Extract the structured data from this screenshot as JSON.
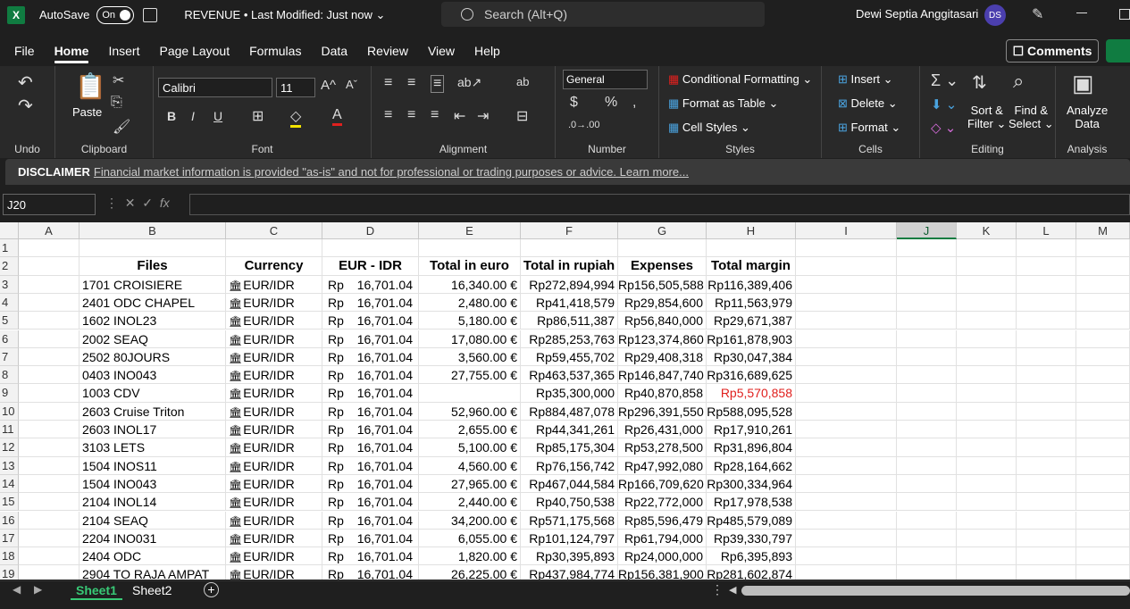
{
  "titlebar": {
    "app_icon": "excel-logo",
    "autosave_label": "AutoSave",
    "autosave_state": "On",
    "doc_title": "REVENUE • Last Modified: Just now ⌄",
    "search_placeholder": "Search (Alt+Q)",
    "user_name": "Dewi Septia Anggitasari",
    "user_initials": "DS"
  },
  "menu": [
    "File",
    "Home",
    "Insert",
    "Page Layout",
    "Formulas",
    "Data",
    "Review",
    "View",
    "Help"
  ],
  "menu_active": "Home",
  "comments_label": "Comments",
  "ribbon": {
    "undo_label": "Undo",
    "clipboard_label": "Clipboard",
    "paste_label": "Paste",
    "font_label": "Font",
    "font_name": "Calibri",
    "font_size": "11",
    "alignment_label": "Alignment",
    "number_label": "Number",
    "number_format": "General",
    "styles_label": "Styles",
    "cond_format": "Conditional Formatting ⌄",
    "format_table": "Format as Table ⌄",
    "cell_styles": "Cell Styles ⌄",
    "cells_label": "Cells",
    "insert": "Insert",
    "delete": "Delete",
    "format": "Format ⌄",
    "editing_label": "Editing",
    "sort_filter_1": "Sort &",
    "sort_filter_2": "Filter ⌄",
    "find_select_1": "Find &",
    "find_select_2": "Select ⌄",
    "analyze_1": "Analyze",
    "analyze_2": "Data",
    "analysis_label": "Analysis"
  },
  "disclaimer": {
    "title": "DISCLAIMER",
    "text": "Financial market information is provided \"as-is\" and not for professional or trading purposes or advice. Learn more..."
  },
  "formula": {
    "name_box": "J20",
    "fx": "fx",
    "value": ""
  },
  "columns": [
    "A",
    "B",
    "C",
    "D",
    "E",
    "F",
    "G",
    "H",
    "I",
    "J",
    "K",
    "L",
    "M"
  ],
  "selected_column": "J",
  "table": {
    "headers": [
      "Files",
      "Currency",
      "EUR - IDR",
      "Total in euro",
      "Total in rupiah",
      "Expenses",
      "Total margin"
    ],
    "rows": [
      {
        "row": "3",
        "file": "1701 CROISIERE",
        "currency": "EUR/IDR",
        "rate": "16,701.04",
        "euro": "16,340.00 €",
        "rupiah": "Rp272,894,994",
        "expenses": "Rp156,505,588",
        "margin": "Rp116,389,406",
        "neg": false
      },
      {
        "row": "4",
        "file": "2401 ODC CHAPEL",
        "currency": "EUR/IDR",
        "rate": "16,701.04",
        "euro": "2,480.00 €",
        "rupiah": "Rp41,418,579",
        "expenses": "Rp29,854,600",
        "margin": "Rp11,563,979",
        "neg": false
      },
      {
        "row": "5",
        "file": "1602 INOL23",
        "currency": "EUR/IDR",
        "rate": "16,701.04",
        "euro": "5,180.00 €",
        "rupiah": "Rp86,511,387",
        "expenses": "Rp56,840,000",
        "margin": "Rp29,671,387",
        "neg": false
      },
      {
        "row": "6",
        "file": "2002 SEAQ",
        "currency": "EUR/IDR",
        "rate": "16,701.04",
        "euro": "17,080.00 €",
        "rupiah": "Rp285,253,763",
        "expenses": "Rp123,374,860",
        "margin": "Rp161,878,903",
        "neg": false
      },
      {
        "row": "7",
        "file": "2502 80JOURS",
        "currency": "EUR/IDR",
        "rate": "16,701.04",
        "euro": "3,560.00 €",
        "rupiah": "Rp59,455,702",
        "expenses": "Rp29,408,318",
        "margin": "Rp30,047,384",
        "neg": false
      },
      {
        "row": "8",
        "file": "0403 INO043",
        "currency": "EUR/IDR",
        "rate": "16,701.04",
        "euro": "27,755.00 €",
        "rupiah": "Rp463,537,365",
        "expenses": "Rp146,847,740",
        "margin": "Rp316,689,625",
        "neg": false
      },
      {
        "row": "9",
        "file": "1003 CDV",
        "currency": "EUR/IDR",
        "rate": "16,701.04",
        "euro": "",
        "rupiah": "Rp35,300,000",
        "expenses": "Rp40,870,858",
        "margin": "Rp5,570,858",
        "neg": true
      },
      {
        "row": "10",
        "file": "2603 Cruise Triton",
        "currency": "EUR/IDR",
        "rate": "16,701.04",
        "euro": "52,960.00 €",
        "rupiah": "Rp884,487,078",
        "expenses": "Rp296,391,550",
        "margin": "Rp588,095,528",
        "neg": false
      },
      {
        "row": "11",
        "file": "2603 INOL17",
        "currency": "EUR/IDR",
        "rate": "16,701.04",
        "euro": "2,655.00 €",
        "rupiah": "Rp44,341,261",
        "expenses": "Rp26,431,000",
        "margin": "Rp17,910,261",
        "neg": false
      },
      {
        "row": "12",
        "file": "3103 LETS",
        "currency": "EUR/IDR",
        "rate": "16,701.04",
        "euro": "5,100.00 €",
        "rupiah": "Rp85,175,304",
        "expenses": "Rp53,278,500",
        "margin": "Rp31,896,804",
        "neg": false
      },
      {
        "row": "13",
        "file": "1504 INOS11",
        "currency": "EUR/IDR",
        "rate": "16,701.04",
        "euro": "4,560.00 €",
        "rupiah": "Rp76,156,742",
        "expenses": "Rp47,992,080",
        "margin": "Rp28,164,662",
        "neg": false
      },
      {
        "row": "14",
        "file": "1504 INO043",
        "currency": "EUR/IDR",
        "rate": "16,701.04",
        "euro": "27,965.00 €",
        "rupiah": "Rp467,044,584",
        "expenses": "Rp166,709,620",
        "margin": "Rp300,334,964",
        "neg": false
      },
      {
        "row": "15",
        "file": "2104 INOL14",
        "currency": "EUR/IDR",
        "rate": "16,701.04",
        "euro": "2,440.00 €",
        "rupiah": "Rp40,750,538",
        "expenses": "Rp22,772,000",
        "margin": "Rp17,978,538",
        "neg": false
      },
      {
        "row": "16",
        "file": "2104 SEAQ",
        "currency": "EUR/IDR",
        "rate": "16,701.04",
        "euro": "34,200.00 €",
        "rupiah": "Rp571,175,568",
        "expenses": "Rp85,596,479",
        "margin": "Rp485,579,089",
        "neg": false
      },
      {
        "row": "17",
        "file": "2204 INO031",
        "currency": "EUR/IDR",
        "rate": "16,701.04",
        "euro": "6,055.00 €",
        "rupiah": "Rp101,124,797",
        "expenses": "Rp61,794,000",
        "margin": "Rp39,330,797",
        "neg": false
      },
      {
        "row": "18",
        "file": "2404 ODC",
        "currency": "EUR/IDR",
        "rate": "16,701.04",
        "euro": "1,820.00 €",
        "rupiah": "Rp30,395,893",
        "expenses": "Rp24,000,000",
        "margin": "Rp6,395,893",
        "neg": false
      },
      {
        "row": "19",
        "file": "2904 TO RAJA AMPAT",
        "currency": "EUR/IDR",
        "rate": "16,701.04",
        "euro": "26,225.00 €",
        "rupiah": "Rp437,984,774",
        "expenses": "Rp156,381,900",
        "margin": "Rp281,602,874",
        "neg": false
      }
    ]
  },
  "rp_prefix": "Rp",
  "sheets": [
    "Sheet1",
    "Sheet2"
  ],
  "active_sheet": "Sheet1",
  "colors": {
    "excel_green": "#107c41",
    "negative_red": "#e0201e",
    "active_tab": "#38c976"
  }
}
